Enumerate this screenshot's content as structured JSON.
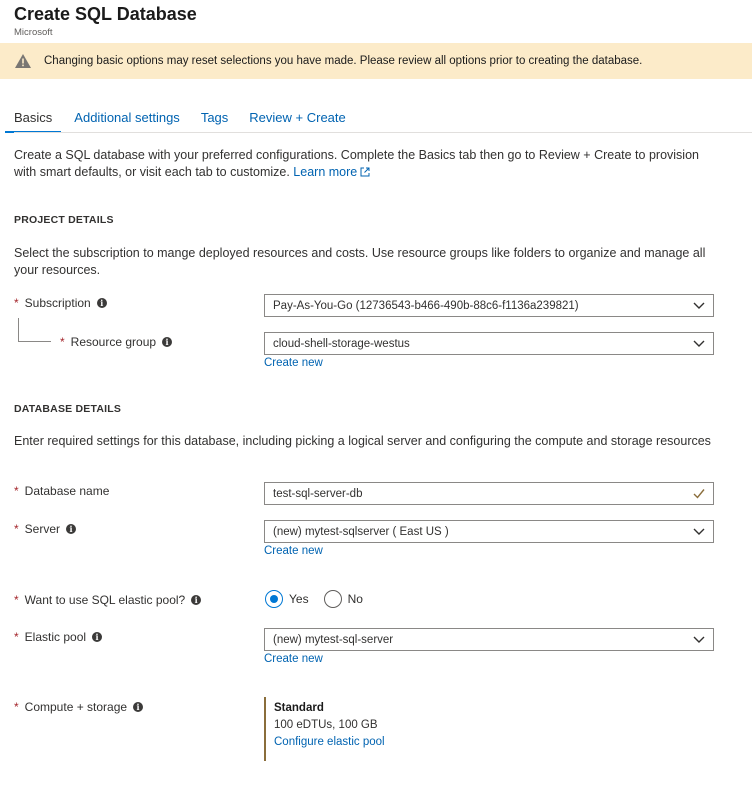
{
  "header": {
    "title": "Create SQL Database",
    "publisher": "Microsoft"
  },
  "warning": {
    "text": "Changing basic options may reset selections you have made. Please review all options prior to creating the database."
  },
  "tabs": [
    {
      "label": "Basics"
    },
    {
      "label": "Additional settings"
    },
    {
      "label": "Tags"
    },
    {
      "label": "Review + Create"
    }
  ],
  "intro": {
    "text": "Create a SQL database with your preferred configurations. Complete the Basics tab then go to Review + Create to provision with smart defaults, or visit each tab to customize.",
    "learn_more": "Learn more"
  },
  "project": {
    "heading": "PROJECT DETAILS",
    "description": "Select the subscription to mange deployed resources and costs. Use resource groups like folders to organize and manage all your resources.",
    "subscription_label": "Subscription",
    "subscription_value": "Pay-As-You-Go (12736543-b466-490b-88c6-f1136a239821)",
    "resource_group_label": "Resource group",
    "resource_group_value": "cloud-shell-storage-westus",
    "create_new": "Create new"
  },
  "database": {
    "heading": "DATABASE DETAILS",
    "description": "Enter required settings for this database, including picking a logical server and configuring the compute and storage resources",
    "db_name_label": "Database name",
    "db_name_value": "test-sql-server-db",
    "server_label": "Server",
    "server_value": "(new) mytest-sqlserver ( East US )",
    "server_create_new": "Create new",
    "elastic_question": "Want to use SQL elastic pool?",
    "yes": "Yes",
    "no": "No",
    "elastic_selected": "Yes",
    "elastic_pool_label": "Elastic pool",
    "elastic_pool_value": "(new) mytest-sql-server",
    "elastic_create_new": "Create new",
    "compute_label": "Compute + storage",
    "compute_tier": "Standard",
    "compute_spec": "100 eDTUs, 100 GB",
    "configure_link": "Configure elastic pool"
  },
  "required_mark": "*",
  "info_glyph": "i",
  "colors": {
    "accent": "#0078d4",
    "link": "#0063b1",
    "warning_bg": "#fcebc9",
    "required": "#a4262c",
    "valid_check": "#8a6d3b"
  },
  "icons": {
    "warning": "warning-icon",
    "external": "external-link-icon",
    "chevron": "chevron-down-icon",
    "check": "checkmark-icon",
    "info": "info-icon"
  }
}
